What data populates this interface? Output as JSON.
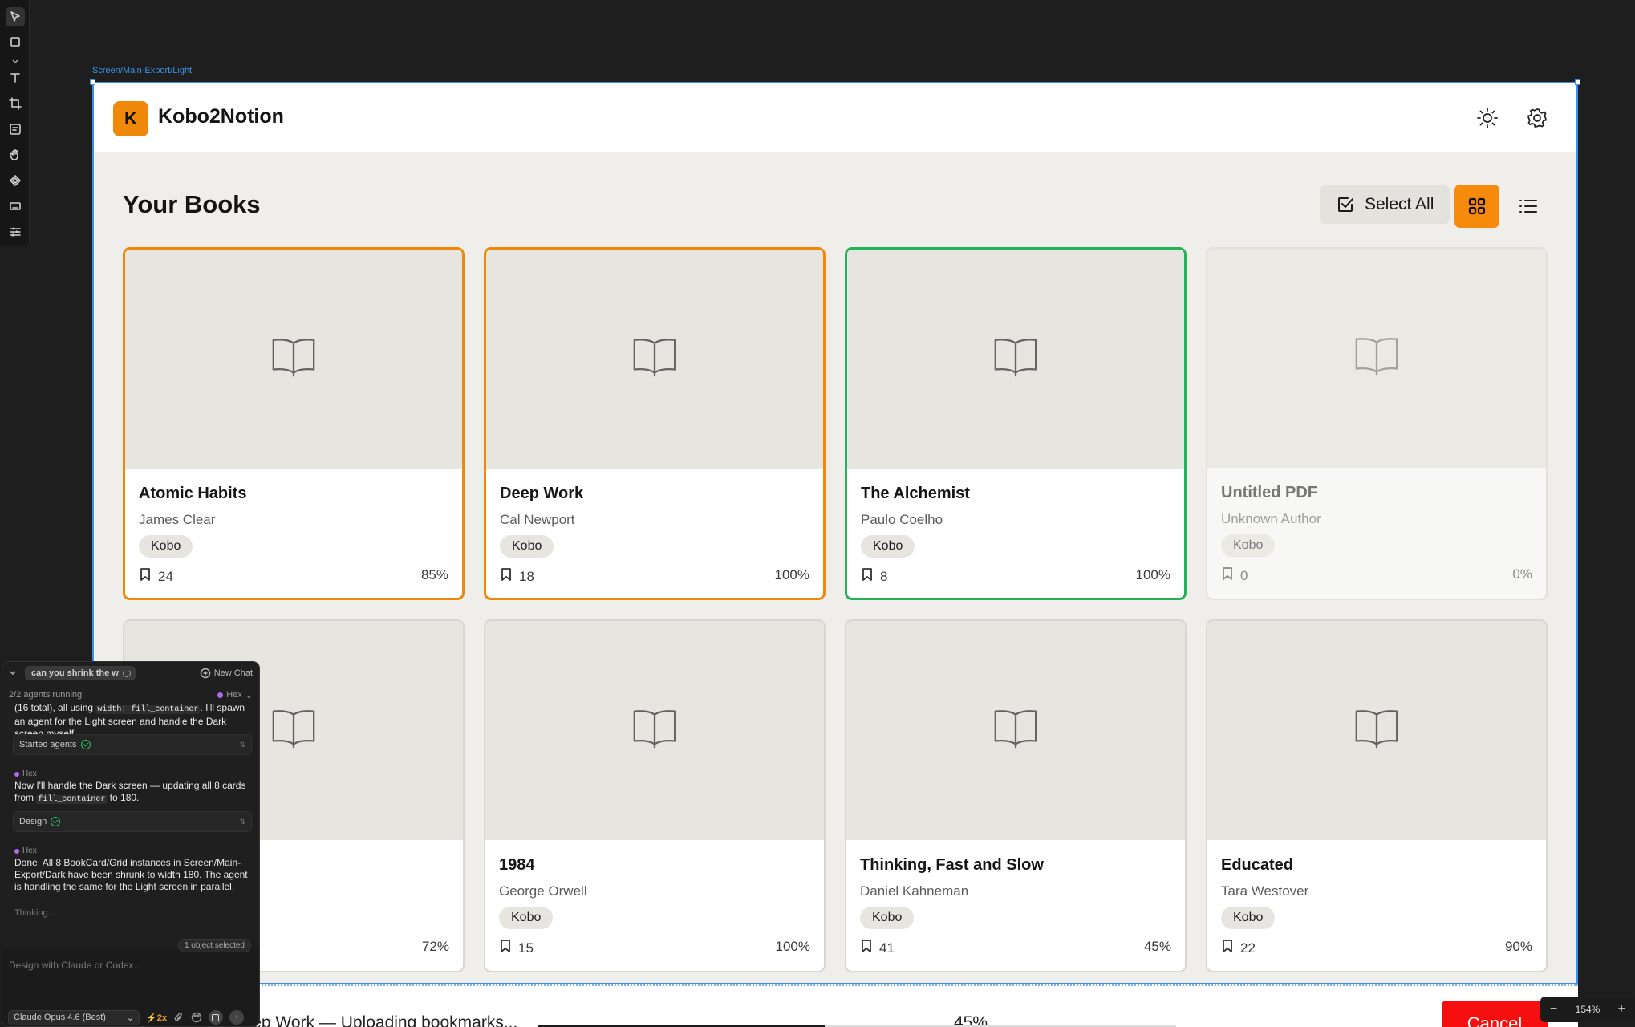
{
  "frame": {
    "label": "Screen/Main-Export/Light"
  },
  "app": {
    "logo_letter": "K",
    "title": "Kobo2Notion"
  },
  "main": {
    "heading": "Your Books",
    "select_all_label": "Select All",
    "accent_color": "#f68a0a",
    "selected_color": "#22b358"
  },
  "books": [
    {
      "title": "Atomic Habits",
      "author": "James Clear",
      "source": "Kobo",
      "bookmarks": "24",
      "progress": "85%",
      "state": "selected-orange"
    },
    {
      "title": "Deep Work",
      "author": "Cal Newport",
      "source": "Kobo",
      "bookmarks": "18",
      "progress": "100%",
      "state": "selected-orange"
    },
    {
      "title": "The Alchemist",
      "author": "Paulo Coelho",
      "source": "Kobo",
      "bookmarks": "8",
      "progress": "100%",
      "state": "selected-green"
    },
    {
      "title": "Untitled PDF",
      "author": "Unknown Author",
      "source": "Kobo",
      "bookmarks": "0",
      "progress": "0%",
      "state": "disabled"
    },
    {
      "title": "",
      "author": "",
      "source": "",
      "bookmarks": "",
      "progress": "72%",
      "state": "normal"
    },
    {
      "title": "1984",
      "author": "George Orwell",
      "source": "Kobo",
      "bookmarks": "15",
      "progress": "100%",
      "state": "normal"
    },
    {
      "title": "Thinking, Fast and Slow",
      "author": "Daniel Kahneman",
      "source": "Kobo",
      "bookmarks": "41",
      "progress": "45%",
      "state": "normal"
    },
    {
      "title": "Educated",
      "author": "Tara Westover",
      "source": "Kobo",
      "bookmarks": "22",
      "progress": "90%",
      "state": "normal"
    }
  ],
  "export": {
    "status_text": "Exporting: Deep Work — Uploading bookmarks...",
    "percent_label": "45%",
    "percent": 45,
    "cancel_label": "Cancel"
  },
  "zoom": {
    "minus": "−",
    "level": "154%",
    "plus": "+"
  },
  "chat": {
    "prompt_pill": "can you shrink the w",
    "new_chat_label": "New Chat",
    "agents_status": "2/2 agents running",
    "agent_name": "Hex",
    "messages": {
      "m1_line_a_pre": "(16 total), all using ",
      "m1_code": "width: fill_container",
      "m1_line_a_post": ". I'll",
      "m1_rest": "spawn an agent for the Light screen and handle the Dark screen myself.",
      "tool1": "Started agents",
      "author2": "Hex",
      "m2_pre": "Now I'll handle the Dark screen — updating all 8 cards from ",
      "m2_code": "fill_container",
      "m2_post": " to 180.",
      "tool2": "Design",
      "author3": "Hex",
      "m3": "Done. All 8 BookCard/Grid instances in Screen/Main-Export/Dark have been shrunk to width 180. The agent is handling the same for the Light screen in parallel.",
      "thinking": "Thinking..."
    },
    "selection_badge": "1 object selected",
    "input_placeholder": "Design with Claude or Codex...",
    "model": "Claude Opus 4.6 (Best)",
    "boost": "2x"
  }
}
